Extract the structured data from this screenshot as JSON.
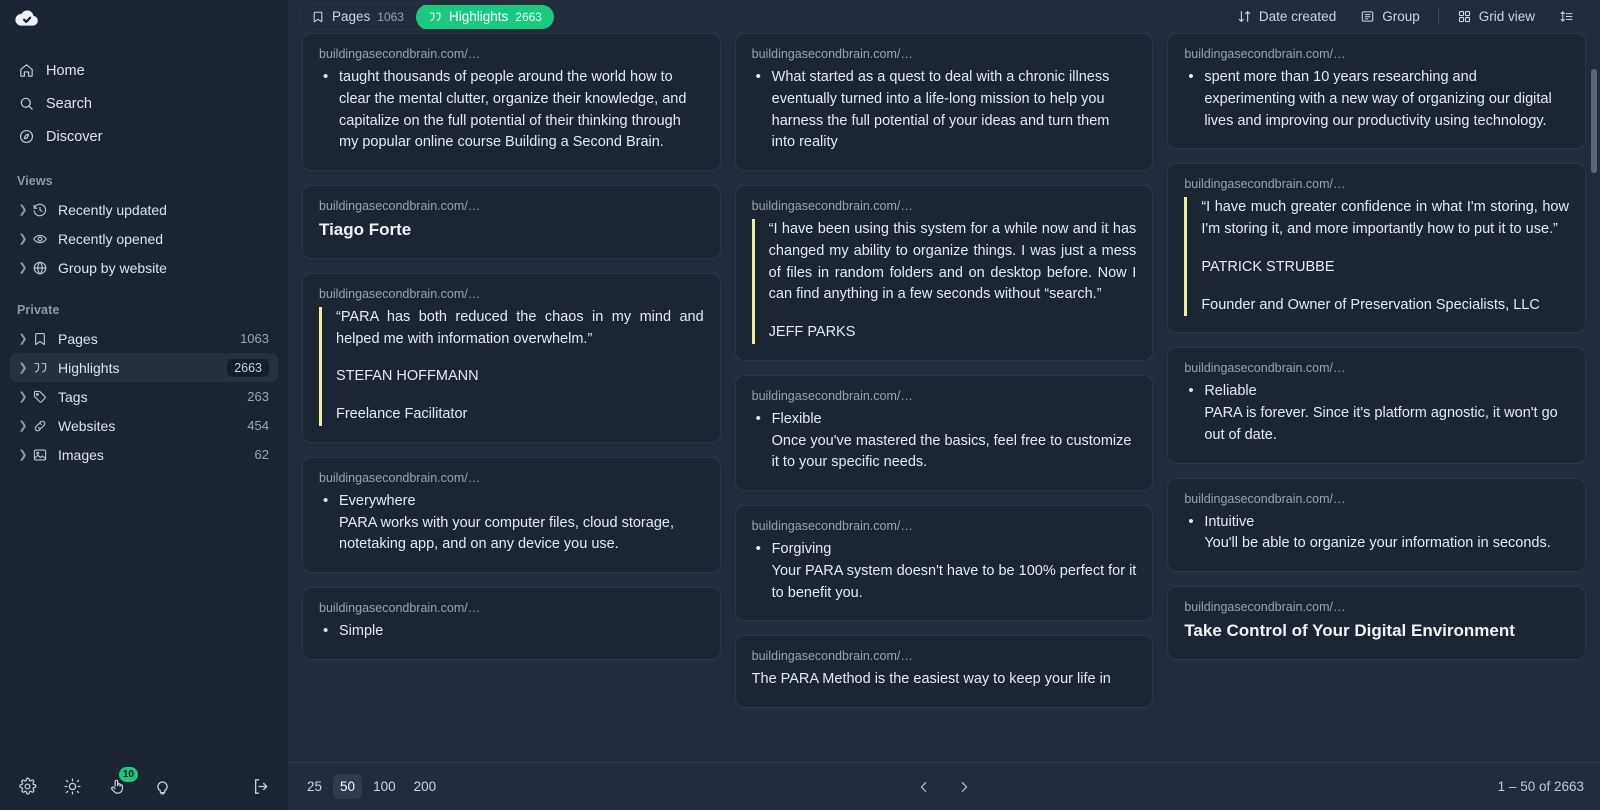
{
  "app": {
    "logo_icon": "cloud-check-icon",
    "background": "#1b2433",
    "accent": "#18c97f",
    "quote_bar_color": "#f0ee9a"
  },
  "sidebar": {
    "nav": [
      {
        "label": "Home",
        "icon": "home-icon"
      },
      {
        "label": "Search",
        "icon": "search-icon"
      },
      {
        "label": "Discover",
        "icon": "compass-icon"
      }
    ],
    "views_title": "Views",
    "views": [
      {
        "label": "Recently updated",
        "icon": "clock-history-icon"
      },
      {
        "label": "Recently opened",
        "icon": "eye-icon"
      },
      {
        "label": "Group by website",
        "icon": "globe-icon"
      }
    ],
    "private_title": "Private",
    "private": [
      {
        "label": "Pages",
        "icon": "bookmark-icon",
        "count": "1063",
        "active": false
      },
      {
        "label": "Highlights",
        "icon": "quotes-icon",
        "count": "2663",
        "active": true
      },
      {
        "label": "Tags",
        "icon": "tag-icon",
        "count": "263",
        "active": false
      },
      {
        "label": "Websites",
        "icon": "link-icon",
        "count": "454",
        "active": false
      },
      {
        "label": "Images",
        "icon": "image-icon",
        "count": "62",
        "active": false
      }
    ],
    "footer": [
      {
        "name": "settings-button",
        "icon": "gear-icon",
        "badge": null
      },
      {
        "name": "theme-button",
        "icon": "sun-icon",
        "badge": null
      },
      {
        "name": "notifications-button",
        "icon": "hand-pointer-icon",
        "badge": "10"
      },
      {
        "name": "tips-button",
        "icon": "lightbulb-icon",
        "badge": null
      },
      {
        "name": "logout-button",
        "icon": "logout-icon",
        "badge": null
      }
    ]
  },
  "topbar": {
    "tabs": [
      {
        "label": "Pages",
        "count": "1063",
        "icon": "bookmark-icon",
        "active": false
      },
      {
        "label": "Highlights",
        "count": "2663",
        "icon": "quotes-icon",
        "active": true
      }
    ],
    "sort_label": "Date created",
    "sort_icon": "sort-arrows-icon",
    "group_label": "Group",
    "group_icon": "list-panel-icon",
    "view_label": "Grid view",
    "view_icon": "grid-icon",
    "density_icon": "density-icon"
  },
  "cards": [
    {
      "id": "card-1",
      "url": "buildingasecondbrain.com/…",
      "variant": "bullet",
      "bullet": "taught thousands of people around the world how to clear the mental clutter, organize their knowledge, and capitalize on the full potential of their thinking through my popular online course Building a Second Brain."
    },
    {
      "id": "card-2",
      "url": "buildingasecondbrain.com/…",
      "variant": "bullet",
      "bullet": "What started as a quest to deal with a chronic illness eventually turned into a life-long mission to help you harness the full potential of your ideas and turn them into reality"
    },
    {
      "id": "card-3",
      "url": "buildingasecondbrain.com/…",
      "variant": "bullet",
      "bullet": "spent more than 10 years researching and experimenting with a new way of organizing our digital lives and improving our productivity using technology."
    },
    {
      "id": "card-4",
      "url": "buildingasecondbrain.com/…",
      "variant": "heading",
      "heading": "Tiago Forte"
    },
    {
      "id": "card-5",
      "url": "buildingasecondbrain.com/…",
      "variant": "quote",
      "quote": "“I have been using this system for a while now and it has changed my ability to organize things. I was just a mess of files in random folders and on desktop before. Now I can find anything in a few seconds without “search.”",
      "attrib1": "JEFF PARKS",
      "attrib2": ""
    },
    {
      "id": "card-6",
      "url": "buildingasecondbrain.com/…",
      "variant": "quote",
      "quote": "“I have much greater confidence in what I'm storing, how I'm storing it, and more importantly how to put it to use.”",
      "attrib1": "PATRICK STRUBBE",
      "attrib2": "Founder and Owner of Preservation Specialists, LLC"
    },
    {
      "id": "card-7",
      "url": "buildingasecondbrain.com/…",
      "variant": "quote",
      "quote": "“PARA has both reduced the chaos in my mind and helped me with information overwhelm.”",
      "attrib1": "STEFAN HOFFMANN",
      "attrib2": "Freelance Facilitator"
    },
    {
      "id": "card-8",
      "url": "buildingasecondbrain.com/…",
      "variant": "bullet-sub",
      "bullet": "Flexible",
      "sub": "Once you've mastered the basics, feel free to customize it to your specific needs."
    },
    {
      "id": "card-9",
      "url": "buildingasecondbrain.com/…",
      "variant": "bullet-sub",
      "bullet": "Reliable",
      "sub": "PARA is forever. Since it's platform agnostic, it won't go out of date."
    },
    {
      "id": "card-10",
      "url": "buildingasecondbrain.com/…",
      "variant": "bullet-sub",
      "bullet": "Everywhere",
      "sub": "PARA works with your computer files, cloud storage, notetaking app, and on any device you use."
    },
    {
      "id": "card-11",
      "url": "buildingasecondbrain.com/…",
      "variant": "bullet-sub",
      "bullet": "Forgiving",
      "sub": "Your PARA system doesn't have to be 100% perfect for it to benefit you."
    },
    {
      "id": "card-12",
      "url": "buildingasecondbrain.com/…",
      "variant": "bullet-sub",
      "bullet": "Intuitive",
      "sub": "You'll be able to organize your information in seconds."
    },
    {
      "id": "card-13",
      "url": "buildingasecondbrain.com/…",
      "variant": "bullet-sub",
      "bullet": "Simple",
      "sub": ""
    },
    {
      "id": "card-14",
      "url": "buildingasecondbrain.com/…",
      "variant": "plain",
      "plain": "The PARA Method is the easiest way to keep your life in"
    },
    {
      "id": "card-15",
      "url": "buildingasecondbrain.com/…",
      "variant": "heading",
      "heading": "Take Control of Your Digital Environment"
    }
  ],
  "bottombar": {
    "page_sizes": [
      {
        "label": "25",
        "active": false
      },
      {
        "label": "50",
        "active": true
      },
      {
        "label": "100",
        "active": false
      },
      {
        "label": "200",
        "active": false
      }
    ],
    "prev_icon": "chevron-left-icon",
    "next_icon": "chevron-right-icon",
    "range": "1 – 50 of 2663"
  }
}
